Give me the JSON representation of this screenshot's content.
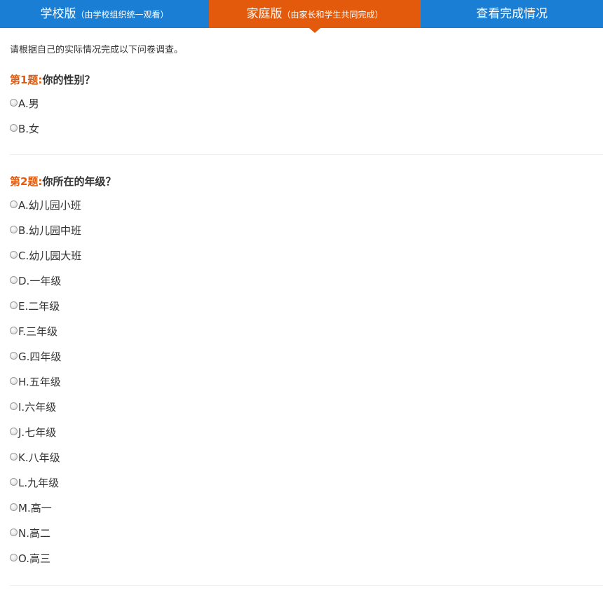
{
  "tabs": [
    {
      "label": "学校版",
      "sub": "（由学校组织统一观看）"
    },
    {
      "label": "家庭版",
      "sub": "（由家长和学生共同完成）"
    },
    {
      "label": "查看完成情况",
      "sub": ""
    }
  ],
  "intro": "请根据自己的实际情况完成以下问卷调查。",
  "questions": [
    {
      "number": "第1题:",
      "text": "你的性别？",
      "options": [
        "A.男",
        "B.女"
      ]
    },
    {
      "number": "第2题:",
      "text": "你所在的年级？",
      "options": [
        "A.幼儿园小班",
        "B.幼儿园中班",
        "C.幼儿园大班",
        "D.一年级",
        "E.二年级",
        "F.三年级",
        "G.四年级",
        "H.五年级",
        "I.六年级",
        "J.七年级",
        "K.八年级",
        "L.九年级",
        "M.高一",
        "N.高二",
        "O.高三"
      ]
    }
  ],
  "colors": {
    "tab_bg": "#1a7fd4",
    "tab_active_bg": "#e45a0c",
    "question_number": "#e45a0c"
  }
}
